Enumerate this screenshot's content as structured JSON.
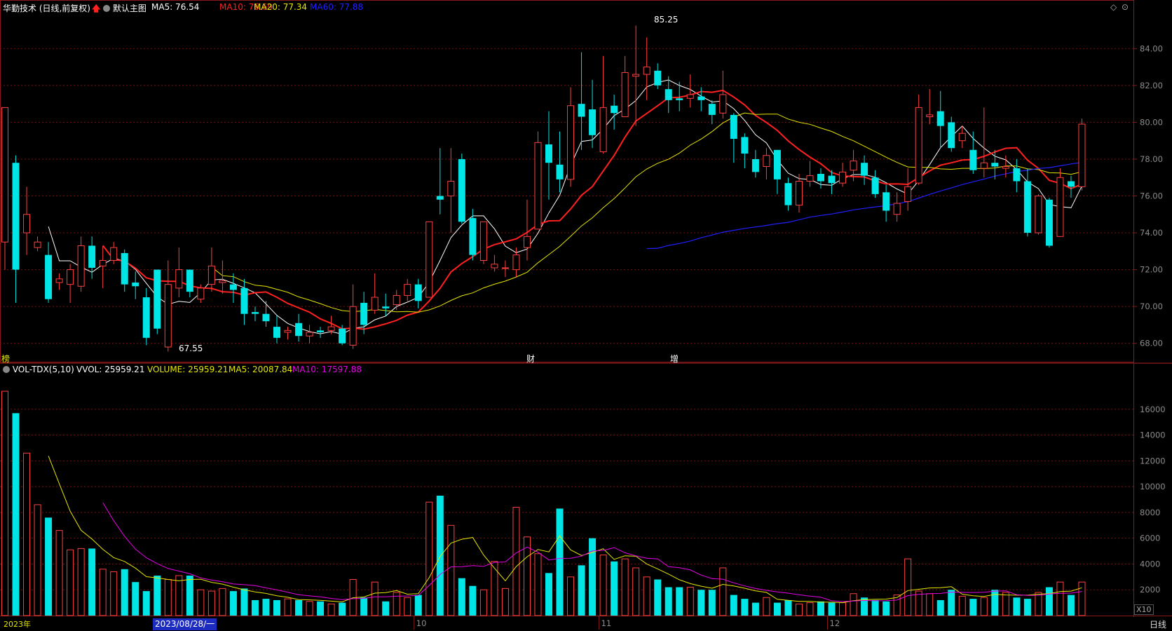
{
  "main_header": {
    "stock_name": "华勤技术 (日线,前复权)",
    "template_label": "默认主图",
    "ma5": "MA5: 76.54",
    "ma10": "MA10: 76.69",
    "ma20": "MA20: 77.34",
    "ma60": "MA60: 77.88"
  },
  "vol_header": {
    "indicator": "VOL-TDX(5,10)",
    "vvol": "VVOL: 25959.21",
    "volume": "VOLUME: 25959.21",
    "ma5": "MA5: 20087.84",
    "ma10": "MA10: 17597.88"
  },
  "annotations": {
    "high": "85.25",
    "low": "67.55",
    "left_marker": "榜",
    "fin_marker": "财",
    "add_marker": "增"
  },
  "bottom_bar": {
    "year_label": "2023年",
    "cursor_date": "2023/08/28/一",
    "view_mode": "日线",
    "zoom": "X10"
  },
  "colors": {
    "up": "#ff4040",
    "down": "#00e5e5",
    "ma5": "#ffffff",
    "ma10": "#ff2020",
    "ma20": "#e6e600",
    "ma60": "#2020ff",
    "vol_ma10": "#e600e6",
    "grid": "#7a1010"
  },
  "chart_data": {
    "type": "candlestick",
    "price_axis": {
      "ticks": [
        "84.00",
        "82.00",
        "80.00",
        "78.00",
        "76.00",
        "74.00",
        "72.00",
        "70.00",
        "68.00"
      ],
      "range": [
        67.0,
        85.8
      ]
    },
    "volume_axis": {
      "ticks": [
        "16000",
        "14000",
        "12000",
        "10000",
        "8000",
        "6000",
        "4000",
        "2000"
      ],
      "range": [
        0,
        18000
      ]
    },
    "x_labels": [
      {
        "label": "10",
        "index": 38
      },
      {
        "label": "11",
        "index": 55
      },
      {
        "label": "12",
        "index": 76
      }
    ],
    "candles": [
      [
        73.5,
        80.8,
        80.8,
        72.0
      ],
      [
        77.8,
        72.0,
        78.2,
        70.2
      ],
      [
        74.0,
        75.0,
        76.5,
        72.8
      ],
      [
        73.2,
        73.5,
        73.8,
        73.0
      ],
      [
        72.8,
        70.4,
        73.5,
        70.2
      ],
      [
        71.3,
        71.5,
        71.8,
        70.9
      ],
      [
        71.2,
        72.0,
        72.3,
        70.2
      ],
      [
        71.1,
        73.3,
        73.8,
        70.8
      ],
      [
        73.3,
        72.1,
        73.8,
        71.5
      ],
      [
        72.2,
        72.5,
        73.3,
        71.0
      ],
      [
        72.5,
        73.2,
        73.5,
        72.3
      ],
      [
        72.9,
        71.2,
        73.1,
        70.8
      ],
      [
        71.3,
        71.1,
        71.9,
        70.4
      ],
      [
        70.5,
        68.3,
        71.0,
        67.9
      ],
      [
        72.0,
        68.8,
        72.0,
        68.5
      ],
      [
        67.8,
        71.2,
        72.5,
        67.55
      ],
      [
        71.0,
        72.0,
        73.2,
        70.5
      ],
      [
        72.0,
        70.8,
        72.0,
        70.5
      ],
      [
        70.4,
        71.0,
        71.2,
        70.2
      ],
      [
        71.2,
        72.2,
        73.2,
        70.8
      ],
      [
        71.3,
        71.4,
        72.5,
        70.7
      ],
      [
        71.2,
        70.9,
        71.8,
        70.2
      ],
      [
        71.0,
        69.6,
        71.5,
        69.0
      ],
      [
        69.7,
        69.6,
        70.0,
        69.2
      ],
      [
        69.6,
        69.2,
        70.3,
        68.9
      ],
      [
        68.9,
        68.3,
        69.5,
        68.0
      ],
      [
        68.6,
        68.7,
        68.9,
        68.2
      ],
      [
        69.1,
        68.4,
        69.6,
        68.1
      ],
      [
        68.4,
        68.6,
        69.0,
        68.0
      ],
      [
        68.7,
        68.6,
        68.9,
        68.3
      ],
      [
        68.7,
        68.9,
        69.5,
        68.5
      ],
      [
        68.8,
        68.0,
        69.0,
        67.9
      ],
      [
        67.9,
        70.0,
        71.2,
        67.7
      ],
      [
        70.2,
        69.0,
        70.8,
        68.5
      ],
      [
        69.8,
        70.5,
        71.8,
        69.6
      ],
      [
        70.0,
        69.9,
        70.7,
        69.5
      ],
      [
        70.1,
        70.6,
        70.9,
        69.8
      ],
      [
        70.6,
        71.2,
        71.5,
        70.3
      ],
      [
        71.2,
        70.3,
        71.5,
        69.9
      ],
      [
        70.5,
        74.6,
        74.6,
        70.5
      ],
      [
        76.0,
        75.8,
        78.6,
        75.0
      ],
      [
        76.0,
        76.8,
        78.6,
        74.0
      ],
      [
        78.0,
        74.6,
        78.3,
        74.5
      ],
      [
        74.8,
        72.8,
        75.3,
        72.5
      ],
      [
        72.5,
        74.6,
        74.6,
        72.3
      ],
      [
        72.1,
        72.3,
        72.8,
        71.9
      ],
      [
        72.1,
        72.1,
        72.5,
        71.6
      ],
      [
        72.0,
        72.8,
        73.2,
        71.6
      ],
      [
        73.2,
        73.8,
        75.8,
        72.5
      ],
      [
        74.2,
        78.9,
        79.5,
        74.2
      ],
      [
        78.8,
        77.8,
        80.6,
        75.8
      ],
      [
        77.7,
        76.9,
        79.5,
        76.2
      ],
      [
        76.9,
        80.9,
        81.9,
        76.5
      ],
      [
        81.0,
        80.3,
        83.8,
        78.5
      ],
      [
        80.7,
        79.3,
        82.3,
        78.6
      ],
      [
        78.4,
        80.8,
        83.6,
        78.3
      ],
      [
        80.9,
        80.5,
        81.5,
        79.6
      ],
      [
        80.3,
        82.7,
        83.6,
        80.3
      ],
      [
        82.5,
        82.6,
        85.25,
        79.8
      ],
      [
        82.6,
        83.0,
        84.6,
        81.2
      ],
      [
        82.8,
        82.0,
        83.2,
        81.8
      ],
      [
        81.8,
        81.2,
        82.5,
        80.5
      ],
      [
        81.3,
        81.2,
        82.2,
        80.6
      ],
      [
        81.3,
        81.5,
        82.6,
        80.8
      ],
      [
        81.4,
        81.2,
        81.9,
        80.6
      ],
      [
        81.0,
        80.4,
        81.2,
        79.9
      ],
      [
        80.5,
        81.5,
        82.8,
        80.2
      ],
      [
        80.4,
        79.1,
        80.5,
        77.8
      ],
      [
        79.2,
        78.3,
        79.4,
        77.5
      ],
      [
        78.0,
        77.3,
        78.5,
        77.0
      ],
      [
        77.6,
        78.2,
        78.6,
        76.9
      ],
      [
        78.5,
        76.9,
        78.5,
        76.1
      ],
      [
        76.7,
        75.5,
        77.0,
        75.2
      ],
      [
        75.5,
        76.8,
        77.2,
        75.1
      ],
      [
        76.8,
        77.1,
        77.9,
        76.5
      ],
      [
        77.2,
        76.8,
        77.5,
        76.4
      ],
      [
        77.1,
        76.7,
        77.4,
        76.1
      ],
      [
        76.7,
        77.3,
        77.8,
        76.5
      ],
      [
        77.4,
        77.9,
        78.5,
        76.8
      ],
      [
        77.8,
        77.1,
        78.2,
        76.6
      ],
      [
        77.0,
        76.1,
        77.4,
        75.9
      ],
      [
        76.2,
        75.2,
        76.6,
        74.6
      ],
      [
        75.0,
        75.6,
        76.2,
        74.6
      ],
      [
        75.7,
        76.5,
        77.5,
        75.2
      ],
      [
        76.7,
        80.8,
        81.5,
        76.6
      ],
      [
        80.3,
        80.4,
        81.8,
        79.9
      ],
      [
        80.6,
        79.8,
        81.7,
        78.6
      ],
      [
        80.0,
        78.6,
        80.3,
        78.4
      ],
      [
        79.0,
        79.4,
        79.8,
        78.6
      ],
      [
        78.5,
        77.4,
        79.5,
        77.2
      ],
      [
        77.5,
        77.8,
        80.8,
        77.0
      ],
      [
        77.8,
        77.6,
        78.5,
        76.9
      ],
      [
        77.5,
        77.6,
        78.2,
        77.0
      ],
      [
        77.5,
        76.8,
        78.0,
        76.2
      ],
      [
        76.8,
        74.0,
        77.5,
        73.8
      ],
      [
        74.0,
        76.0,
        76.1,
        73.9
      ],
      [
        75.8,
        73.3,
        75.9,
        73.2
      ],
      [
        73.8,
        77.0,
        77.5,
        73.8
      ],
      [
        76.8,
        76.5,
        77.1,
        75.9
      ],
      [
        76.5,
        79.9,
        80.2,
        76.3
      ]
    ],
    "volume": [
      17400,
      15700,
      12600,
      8600,
      7600,
      6600,
      5100,
      5200,
      5200,
      3600,
      3400,
      3600,
      2600,
      1900,
      3100,
      2800,
      3100,
      3100,
      2000,
      1900,
      2100,
      1900,
      2100,
      1200,
      1300,
      1200,
      1300,
      1200,
      1100,
      1100,
      900,
      1000,
      2800,
      1400,
      2600,
      1100,
      1800,
      1400,
      1600,
      8800,
      9300,
      7000,
      2900,
      2300,
      2000,
      4200,
      2100,
      8400,
      6100,
      4800,
      3300,
      8300,
      3000,
      3900,
      6000,
      4700,
      4200,
      4400,
      3700,
      3000,
      2800,
      2200,
      2200,
      2200,
      2000,
      2000,
      3700,
      1600,
      1300,
      1000,
      1400,
      1000,
      1200,
      900,
      1000,
      1100,
      1000,
      1000,
      1700,
      1400,
      1200,
      1100,
      1600,
      4400,
      1900,
      1700,
      1200,
      2000,
      1500,
      1300,
      1400,
      2000,
      1800,
      1400,
      1300,
      1800,
      2200,
      2600,
      1600,
      2600
    ]
  }
}
